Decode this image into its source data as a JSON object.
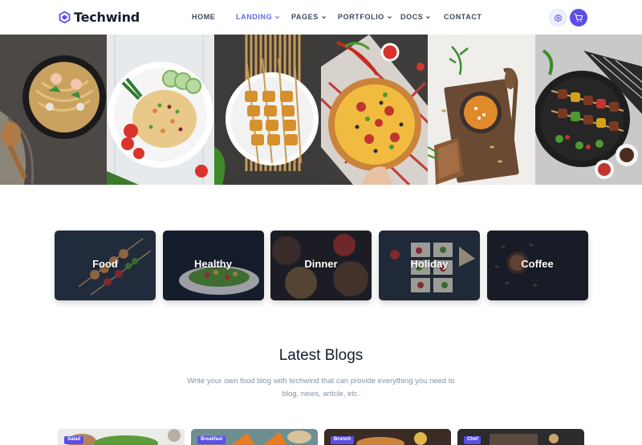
{
  "brand": {
    "name": "Techwind",
    "accent": "#6366f1",
    "text_color": "#161c2d"
  },
  "nav": {
    "items": [
      {
        "label": "HOME",
        "active": false,
        "dropdown": false
      },
      {
        "label": "LANDING",
        "active": true,
        "dropdown": true
      },
      {
        "label": "PAGES",
        "active": false,
        "dropdown": true
      },
      {
        "label": "PORTFOLIO",
        "active": false,
        "dropdown": true
      },
      {
        "label": "DOCS",
        "active": false,
        "dropdown": true
      },
      {
        "label": "CONTACT",
        "active": false,
        "dropdown": false
      }
    ],
    "actions": [
      {
        "icon": "settings-icon"
      },
      {
        "icon": "cart-icon"
      }
    ]
  },
  "gallery": [
    {
      "subject": "noodles"
    },
    {
      "subject": "fried-rice"
    },
    {
      "subject": "skewers"
    },
    {
      "subject": "pizza"
    },
    {
      "subject": "soup"
    },
    {
      "subject": "kebabs"
    }
  ],
  "categories": [
    {
      "label": "Food"
    },
    {
      "label": "Healthy"
    },
    {
      "label": "Dinner"
    },
    {
      "label": "Holiday"
    },
    {
      "label": "Coffee"
    }
  ],
  "blogs": {
    "heading": "Latest Blogs",
    "subtitle": "Write your own food blog with techwind that can provide everything you need to blog, news, article, etc.",
    "posts": [
      {
        "tag": "Salad"
      },
      {
        "tag": "Breakfast"
      },
      {
        "tag": "Brunch"
      },
      {
        "tag": "Chef"
      }
    ]
  }
}
